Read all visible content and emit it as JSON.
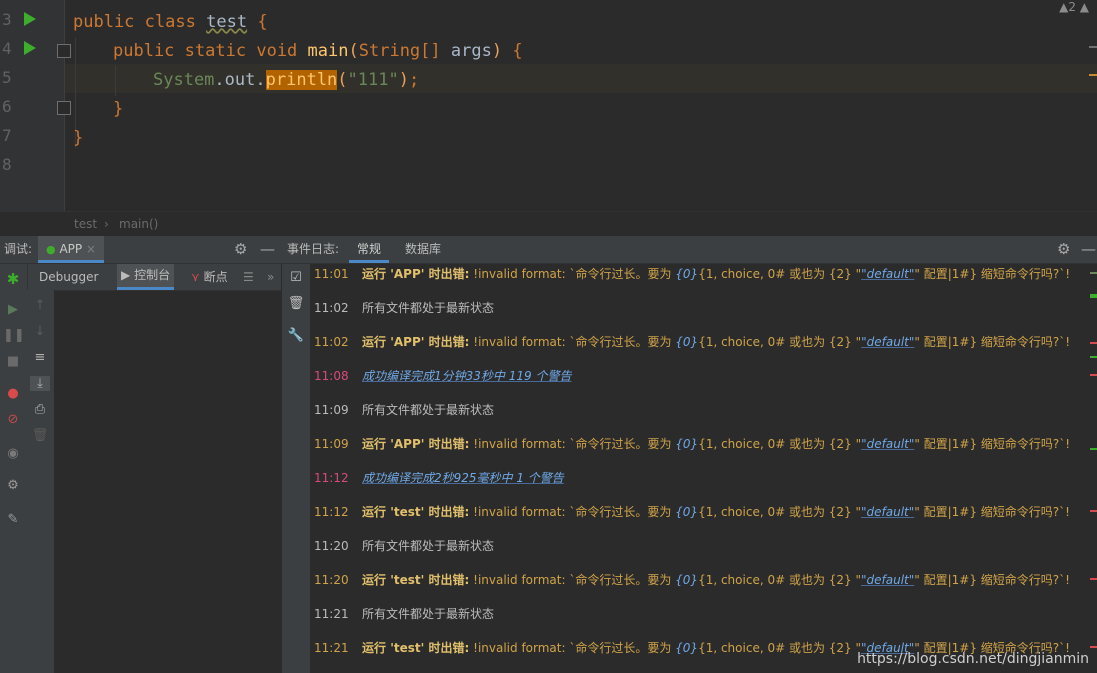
{
  "editor": {
    "line_numbers": [
      "3",
      "4",
      "5",
      "6",
      "7",
      "8"
    ],
    "code": {
      "l3": {
        "kw1": "public",
        "kw2": "class",
        "name": "test",
        "brace": "{"
      },
      "l4": {
        "kw1": "public",
        "kw2": "static",
        "kw3": "void",
        "fn": "main",
        "p_open": "(",
        "type": "String[]",
        "arg": "args",
        "p_close": ")",
        "brace": "{"
      },
      "l5": {
        "obj": "System",
        "dot1": ".",
        "field": "out",
        "dot2": ".",
        "method": "println",
        "p_open": "(",
        "str": "\"111\"",
        "p_close": ")",
        "semi": ";"
      },
      "l6": {
        "brace": "}"
      },
      "l7": {
        "brace": "}"
      }
    },
    "top_right": "▲2  ▲"
  },
  "breadcrumb": {
    "item1": "test",
    "sep": "›",
    "item2": "main()"
  },
  "debug": {
    "label": "调试:",
    "config_tab": "APP",
    "close": "×",
    "subtabs": {
      "debugger": "Debugger",
      "console": "控制台",
      "breakpoints": "断点",
      "more": "»"
    }
  },
  "event_log": {
    "label": "事件日志:",
    "tabs": [
      "常规",
      "数据库"
    ]
  },
  "logs": [
    {
      "time": "11:01",
      "type": "err",
      "target": "'APP'"
    },
    {
      "time": "11:02",
      "type": "plain",
      "msg": "所有文件都处于最新状态"
    },
    {
      "time": "11:02",
      "type": "err",
      "target": "'APP'"
    },
    {
      "time": "11:08",
      "type": "link",
      "msg": "成功编译完成1分钟33秒中 119 个警告"
    },
    {
      "time": "11:09",
      "type": "plain",
      "msg": "所有文件都处于最新状态"
    },
    {
      "time": "11:09",
      "type": "err",
      "target": "'APP'"
    },
    {
      "time": "11:12",
      "type": "link",
      "msg": "成功编译完成2秒925毫秒中 1 个警告"
    },
    {
      "time": "11:12",
      "type": "err",
      "target": "'test'"
    },
    {
      "time": "11:20",
      "type": "plain",
      "msg": "所有文件都处于最新状态"
    },
    {
      "time": "11:20",
      "type": "err",
      "target": "'test'"
    },
    {
      "time": "11:21",
      "type": "plain",
      "msg": "所有文件都处于最新状态"
    },
    {
      "time": "11:21",
      "type": "err",
      "target": "'test'"
    }
  ],
  "err_text": {
    "run": "运行",
    "err": "时出错:",
    "p1": "!invalid format: `命令行过长。要为 ",
    "i1": "{0}",
    "p2": "{1, choice, 0# 或也为 {2} \"",
    "i2": "\"default\"",
    "p3": "\" 配置|1#} 缩短命令行吗?`!"
  },
  "watermark": "https://blog.csdn.net/dingjianmin"
}
